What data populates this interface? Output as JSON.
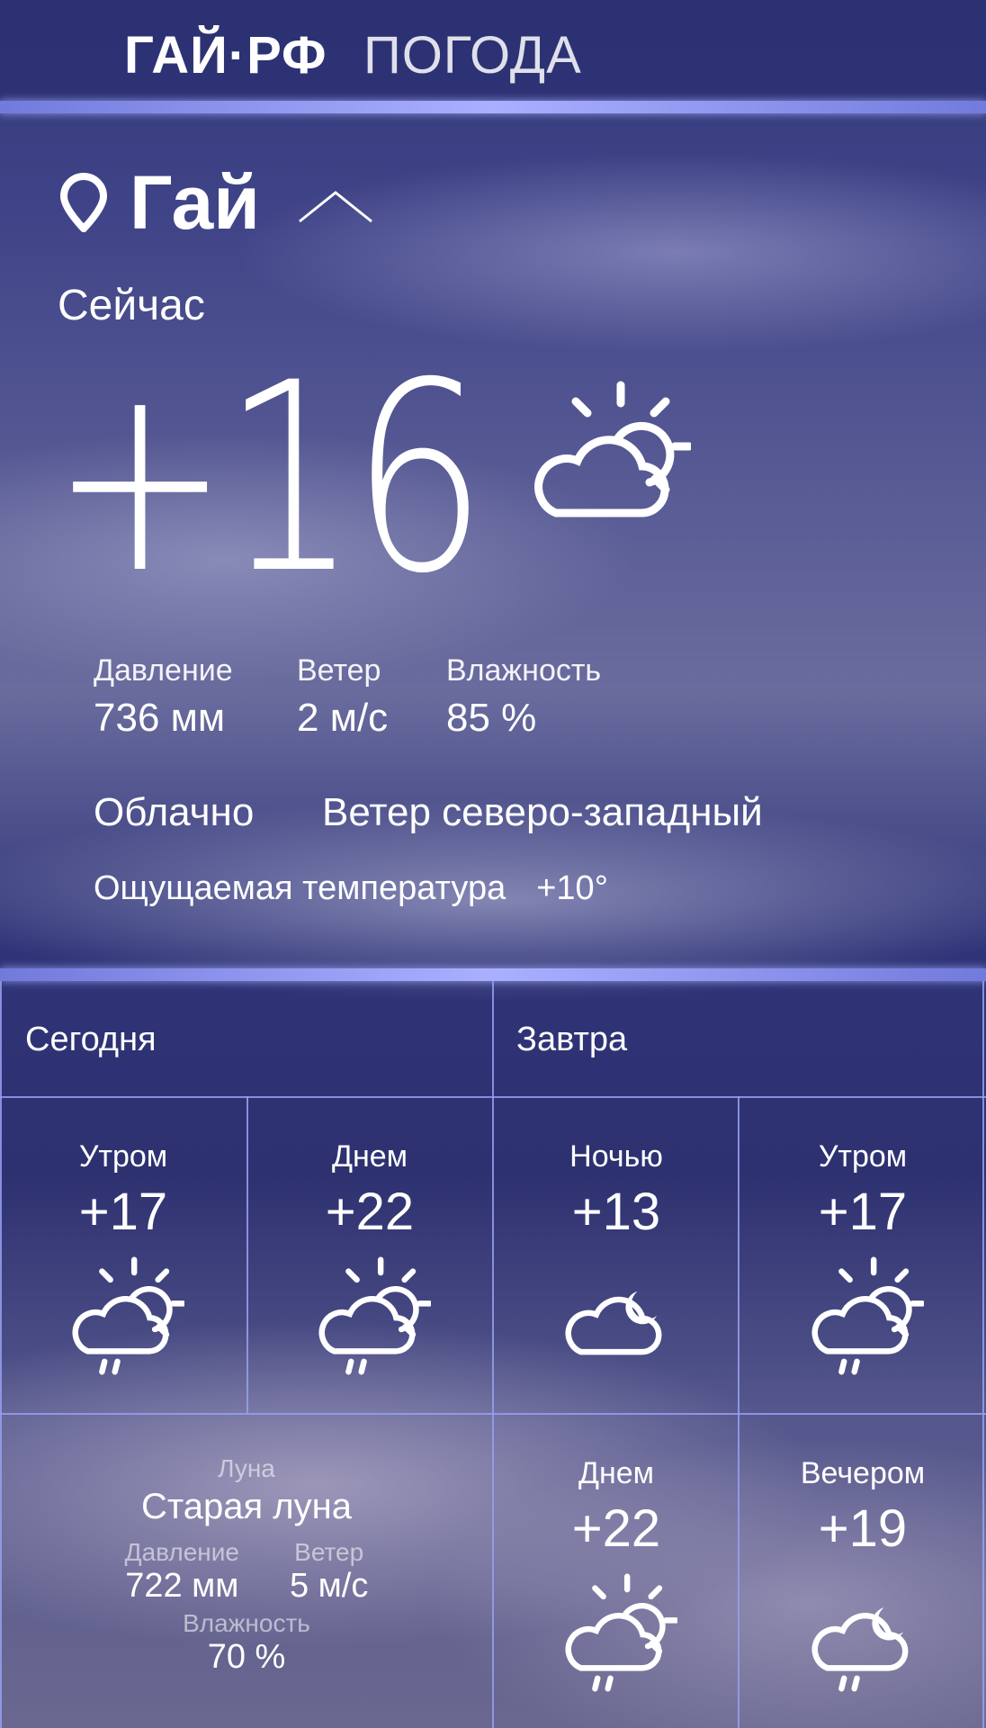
{
  "header": {
    "logo": "ГАЙ·РФ",
    "section": "ПОГОДА"
  },
  "location": {
    "city": "Гай"
  },
  "now": {
    "label": "Сейчас",
    "temperature": "+16",
    "icon": "partly-cloudy-sun-icon",
    "stats": [
      {
        "label": "Давление",
        "value": "736 мм"
      },
      {
        "label": "Ветер",
        "value": "2 м/с"
      },
      {
        "label": "Влажность",
        "value": "85 %"
      }
    ],
    "condition": "Облачно",
    "wind_direction": "Ветер северо-западный",
    "feels_like_label": "Ощущаемая температура",
    "feels_like_value": "+10°"
  },
  "forecast": {
    "today_label": "Сегодня",
    "tomorrow_label": "Завтра",
    "cells": [
      {
        "period": "Утром",
        "temp": "+17",
        "icon": "sun-cloud-rain-icon"
      },
      {
        "period": "Днем",
        "temp": "+22",
        "icon": "sun-cloud-rain-icon"
      },
      {
        "period": "Ночью",
        "temp": "+13",
        "icon": "moon-cloud-icon"
      },
      {
        "period": "Утром",
        "temp": "+17",
        "icon": "sun-cloud-rain-icon"
      },
      {
        "period": "Днем",
        "temp": "+22",
        "icon": "sun-cloud-rain-icon"
      },
      {
        "period": "Вечером",
        "temp": "+19",
        "icon": "moon-cloud-rain-icon"
      }
    ],
    "moon": {
      "label": "Луна",
      "phase": "Старая луна",
      "pressure_label": "Давление",
      "pressure_value": "722 мм",
      "wind_label": "Ветер",
      "wind_value": "5 м/с",
      "humidity_label": "Влажность",
      "humidity_value": "70 %"
    }
  },
  "colors": {
    "grid": "#96a0f0",
    "glow": "#aab0ff"
  }
}
